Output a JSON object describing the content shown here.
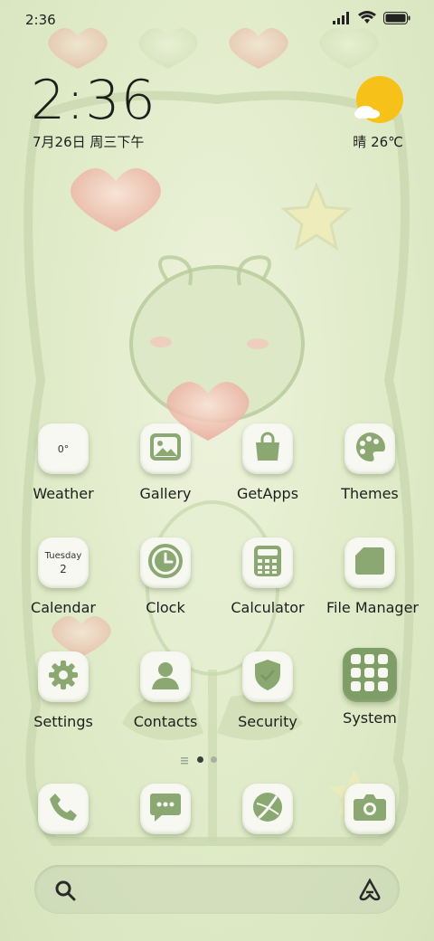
{
  "status_bar": {
    "time": "2:36",
    "icons": [
      "signal-icon",
      "wifi-icon",
      "battery-icon"
    ]
  },
  "clock_widget": {
    "time": "2:36",
    "date": "7月26日 周三下午"
  },
  "weather_widget": {
    "condition_icon": "sun-cloud-icon",
    "condition_temp": "晴 26℃"
  },
  "apps": [
    {
      "label": "Weather",
      "icon": "weather-icon",
      "badge": "0°"
    },
    {
      "label": "Gallery",
      "icon": "gallery-icon"
    },
    {
      "label": "GetApps",
      "icon": "shopping-bag-icon"
    },
    {
      "label": "Themes",
      "icon": "palette-icon"
    },
    {
      "label": "Calendar",
      "icon": "calendar-icon",
      "day_name": "Tuesday",
      "day_num": "2"
    },
    {
      "label": "Clock",
      "icon": "clock-icon"
    },
    {
      "label": "Calculator",
      "icon": "calculator-icon"
    },
    {
      "label": "File Manager",
      "icon": "folder-icon"
    },
    {
      "label": "Settings",
      "icon": "gear-icon"
    },
    {
      "label": "Contacts",
      "icon": "person-icon"
    },
    {
      "label": "Security",
      "icon": "shield-icon"
    },
    {
      "label": "System",
      "icon": "app-folder-icon"
    }
  ],
  "page_indicator": {
    "pages": 2,
    "current": 1
  },
  "dock": [
    {
      "name": "phone",
      "icon": "phone-icon"
    },
    {
      "name": "messages",
      "icon": "message-icon"
    },
    {
      "name": "browser",
      "icon": "browser-icon"
    },
    {
      "name": "camera",
      "icon": "camera-icon"
    }
  ],
  "search_bar": {
    "left_icon": "search-icon",
    "right_icon": "assistant-icon"
  },
  "colors": {
    "accent": "#8ba872",
    "accent_dark": "#6f8f58",
    "tile": "#f7f8f1",
    "sun": "#f6c21a"
  }
}
